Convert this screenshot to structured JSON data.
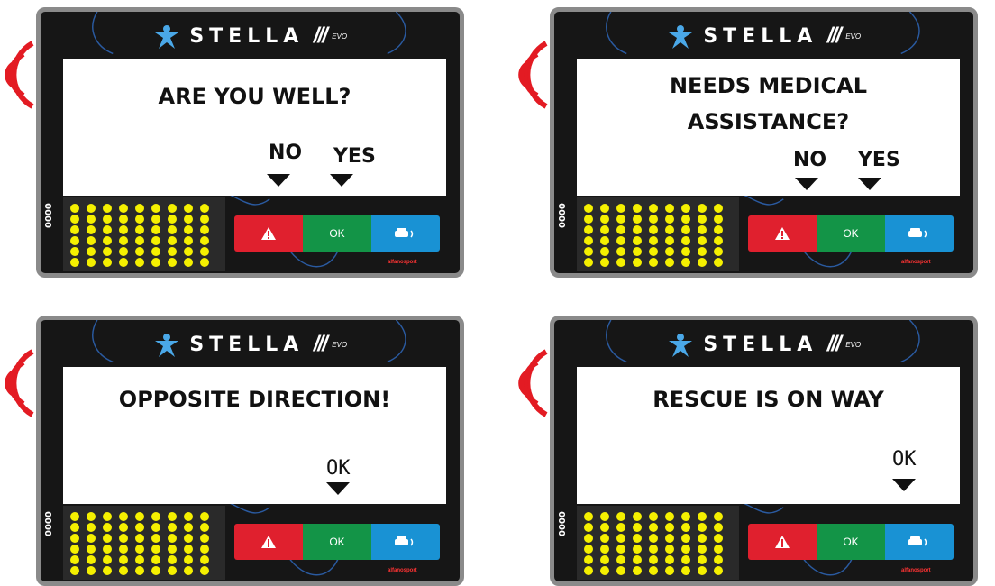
{
  "brand": {
    "name": "STELLA",
    "series": "///",
    "edition": "EVO"
  },
  "panels": [
    {
      "question": "ARE YOU WELL?",
      "options": [
        "NO",
        "YES"
      ]
    },
    {
      "question": "NEEDS MEDICAL ASSISTANCE?",
      "options": [
        "NO",
        "YES"
      ]
    },
    {
      "question": "OPPOSITE DIRECTION!",
      "options": [
        "OK"
      ]
    },
    {
      "question": "RESCUE IS ON WAY",
      "options": [
        "OK"
      ]
    }
  ],
  "buttons": {
    "ok_label": "OK"
  },
  "serial": "0000",
  "maker": "alfanosport",
  "colors": {
    "alert_red": "#e0202e",
    "ok_green": "#139447",
    "info_blue": "#1992d4",
    "led_yellow": "#f5f000",
    "signal_red": "#e31b23"
  }
}
